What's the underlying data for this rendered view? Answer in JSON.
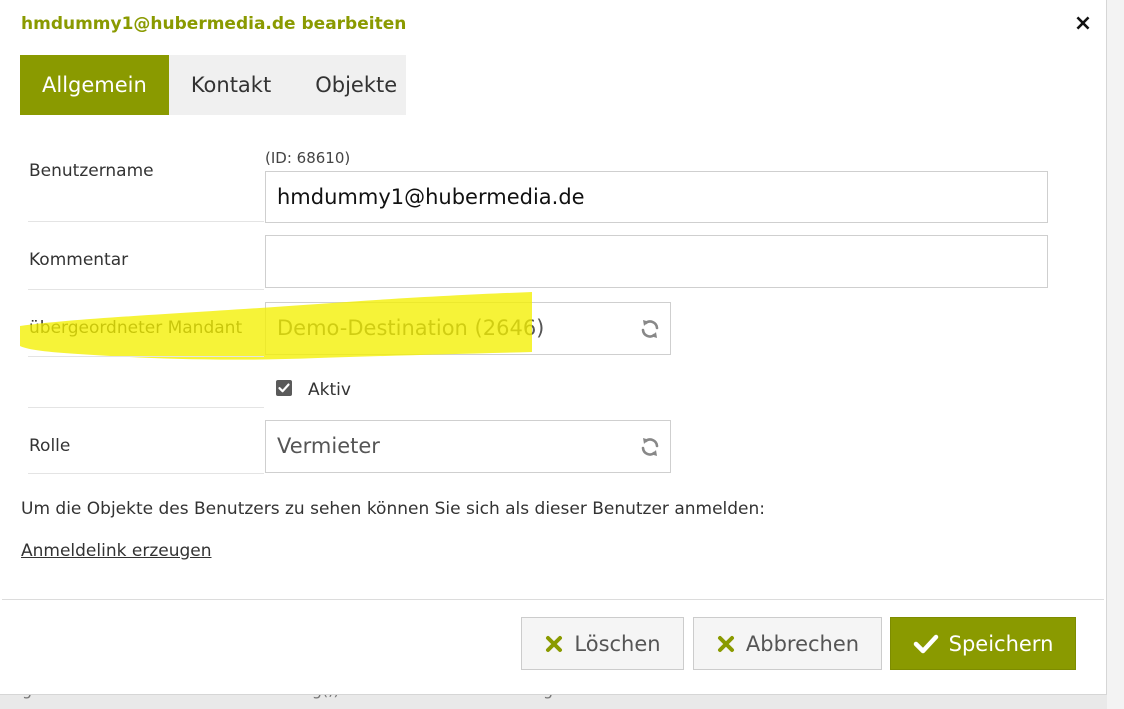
{
  "dialog": {
    "title": "hmdummy1@hubermedia.de bearbeiten",
    "close_label": "×"
  },
  "tabs": [
    {
      "label": "Allgemein",
      "active": true
    },
    {
      "label": "Kontakt",
      "active": false
    },
    {
      "label": "Objekte",
      "active": false
    }
  ],
  "form": {
    "username": {
      "label": "Benutzername",
      "id_hint": "(ID: 68610)",
      "value": "hmdummy1@hubermedia.de"
    },
    "comment": {
      "label": "Kommentar",
      "value": ""
    },
    "parent_client": {
      "label": "übergeordneter Mandant",
      "value": "Demo-Destination (2646)"
    },
    "active": {
      "label": "Aktiv",
      "checked": true
    },
    "role": {
      "label": "Rolle",
      "value": "Vermieter"
    }
  },
  "info": {
    "text": "Um die Objekte des Benutzers zu sehen können Sie sich als dieser Benutzer anmelden:",
    "link": "Anmeldelink erzeugen"
  },
  "buttons": {
    "delete": "Löschen",
    "cancel": "Abbrechen",
    "save": "Speichern"
  },
  "colors": {
    "accent": "#8a9a00",
    "highlight": "#f4f000"
  }
}
